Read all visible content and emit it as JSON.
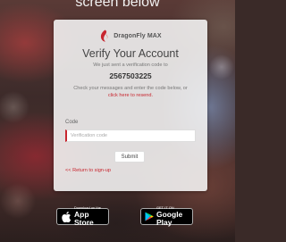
{
  "caption": "screen below",
  "brand": {
    "name": "DragonFly MAX",
    "accent": "#c8262f"
  },
  "verify": {
    "title": "Verify Your Account",
    "sent_text": "We just sent a verification code to",
    "phone": "2567503225",
    "instructions": "Check your messages and enter the code below, or",
    "resend_link": "click here to resend.",
    "code_label": "Code",
    "code_placeholder": "Verification code",
    "submit_label": "Submit",
    "back_link": "<< Return to sign-up"
  },
  "stores": {
    "apple": {
      "small": "Download on the",
      "big": "App Store",
      "icon": "apple-logo-icon"
    },
    "google": {
      "small": "GET IT ON",
      "big": "Google Play",
      "icon": "google-play-icon"
    }
  }
}
